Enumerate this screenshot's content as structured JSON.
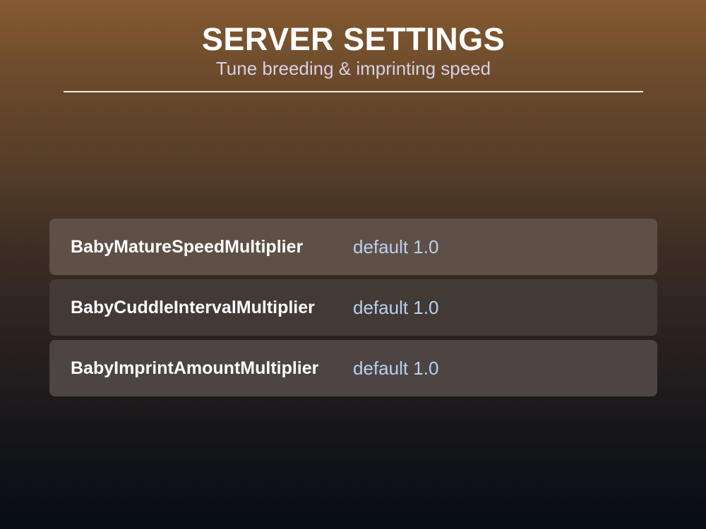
{
  "header": {
    "title": "SERVER SETTINGS",
    "subtitle": "Tune breeding & imprinting speed"
  },
  "settings": [
    {
      "name": "BabyMatureSpeedMultiplier",
      "default": "default 1.0"
    },
    {
      "name": "BabyCuddleIntervalMultiplier",
      "default": "default 1.0"
    },
    {
      "name": "BabyImprintAmountMultiplier",
      "default": "default 1.0"
    }
  ],
  "colors": {
    "text_primary": "#ffffff",
    "text_default_value": "#b9cfee",
    "subtitle": "#d8d0e4",
    "divider": "#f0ebe6"
  }
}
